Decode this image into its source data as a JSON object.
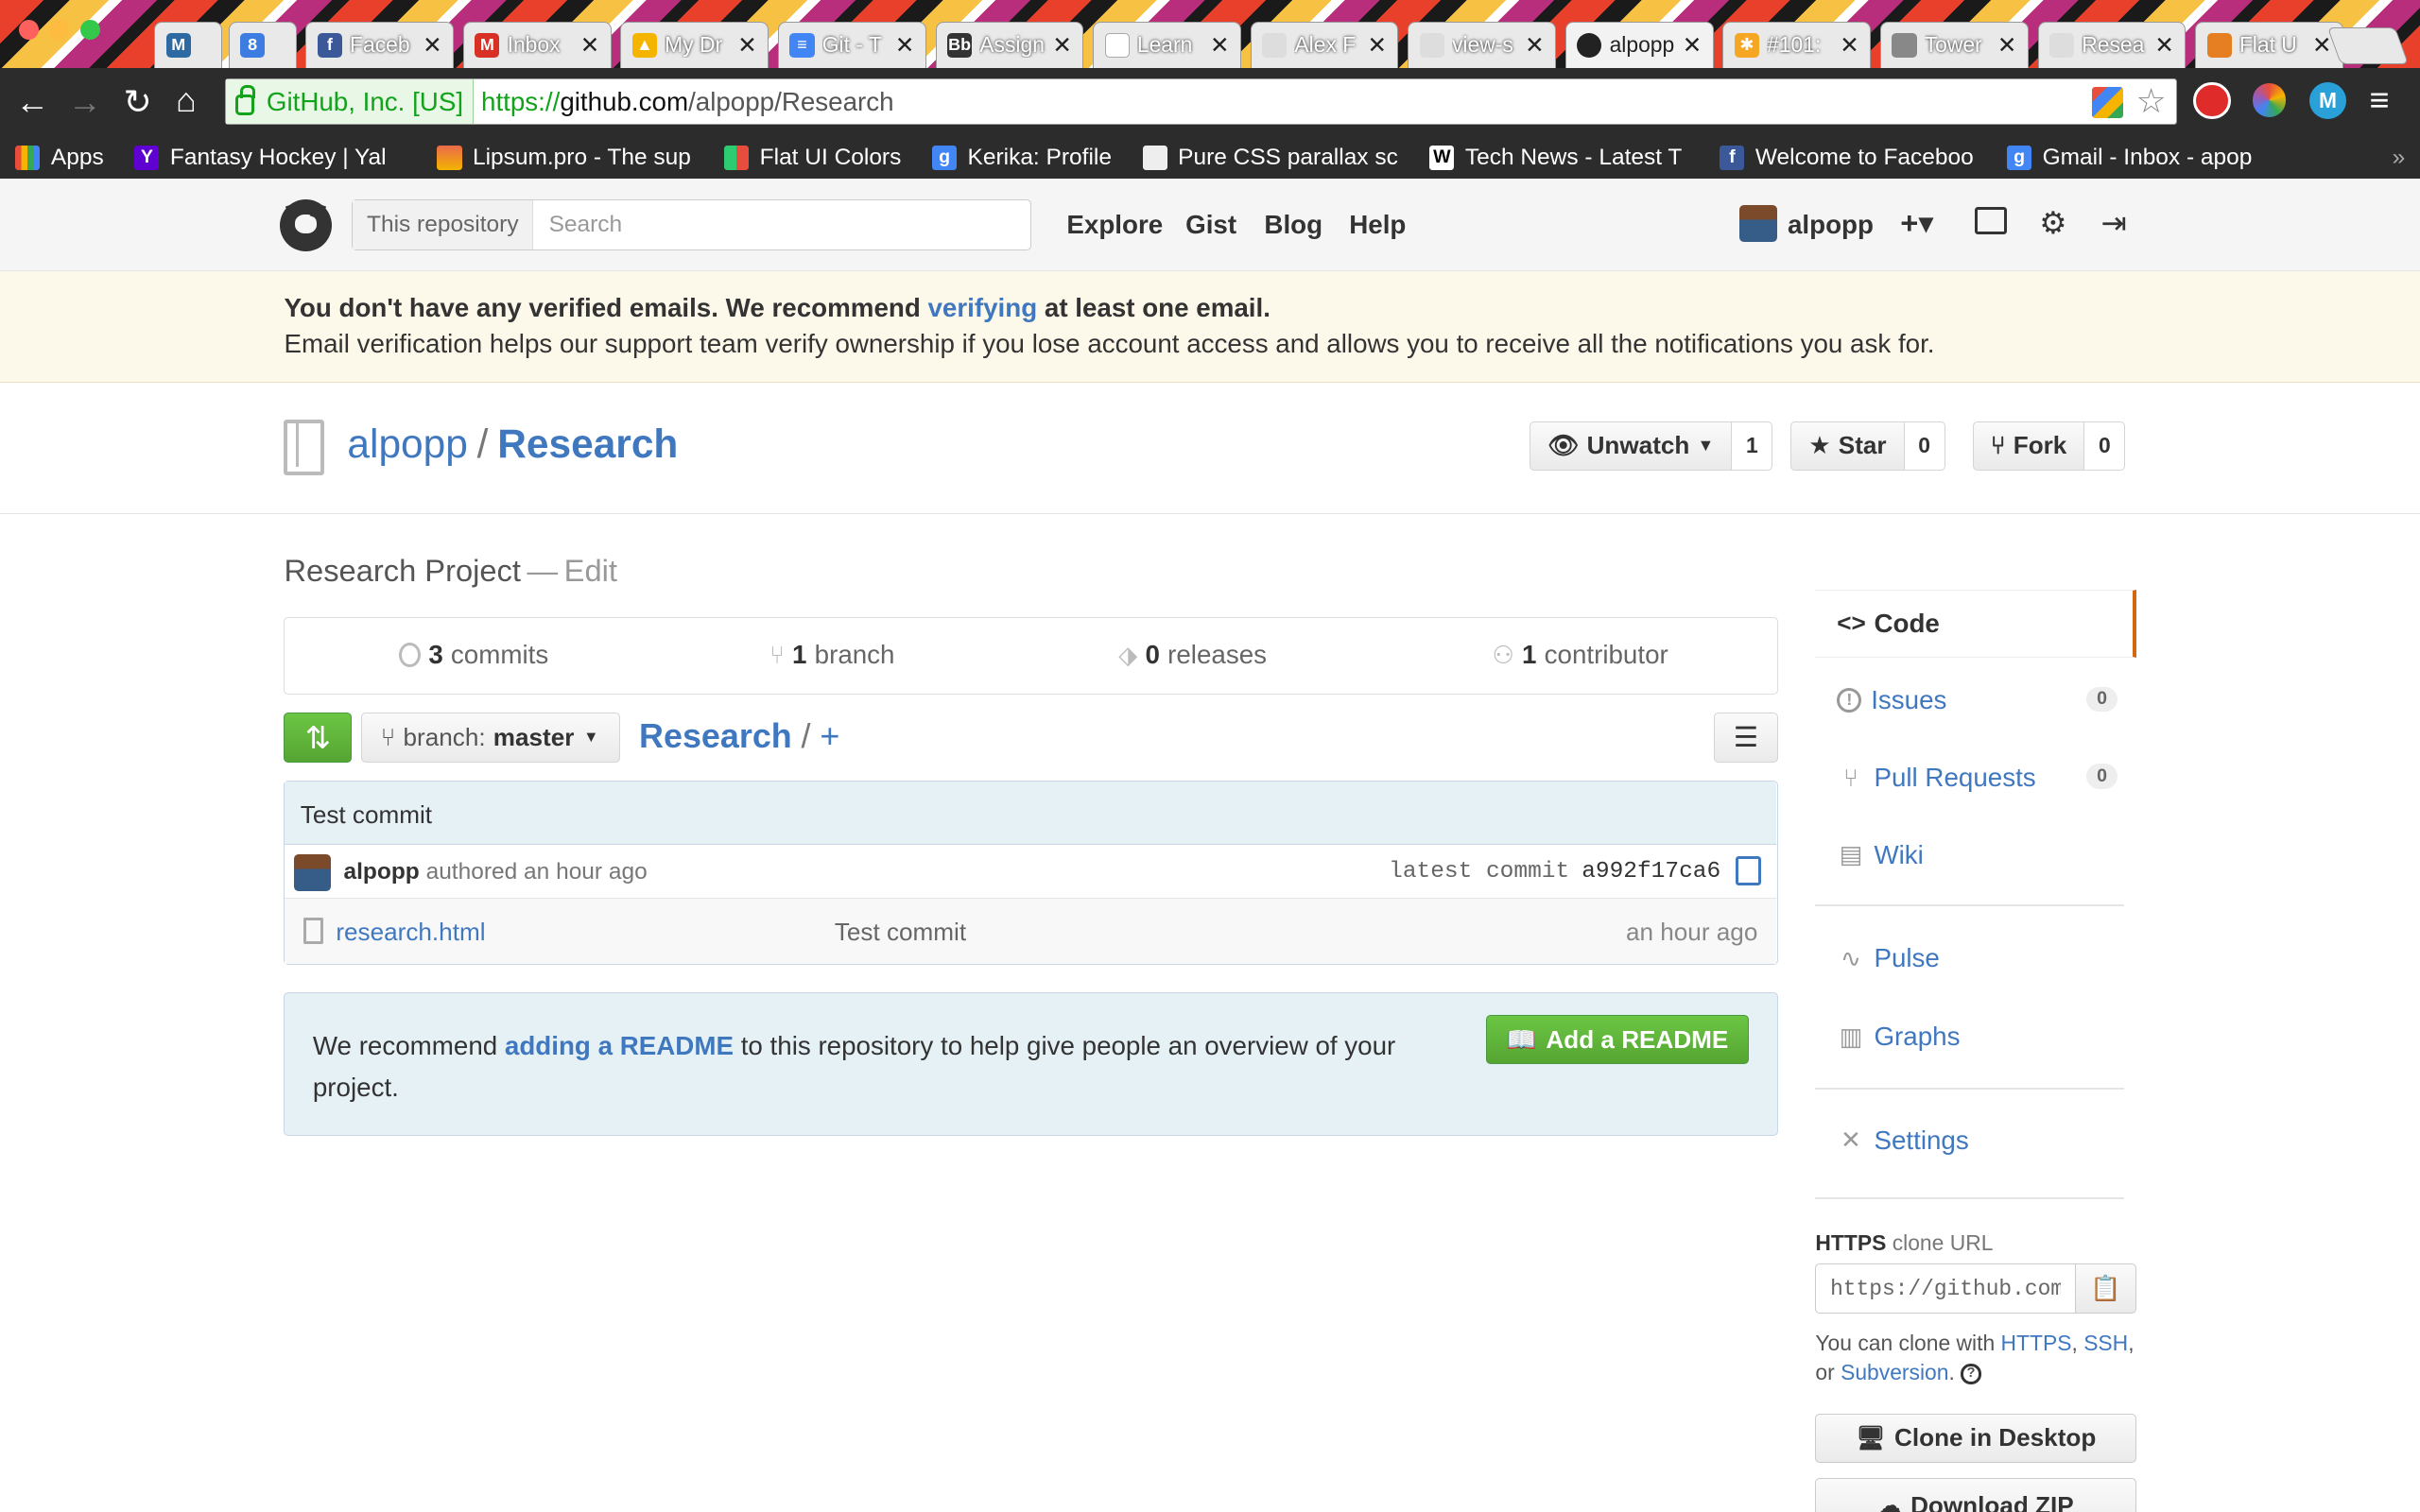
{
  "browser": {
    "tabs": [
      {
        "icon": "M",
        "label": "",
        "color": "#2d6aa3"
      },
      {
        "icon": "8",
        "label": "",
        "color": "#3d7ce0"
      },
      {
        "icon": "f",
        "label": "Faceb",
        "color": "#3b5998"
      },
      {
        "icon": "M",
        "label": "Inbox",
        "color": "#d93025"
      },
      {
        "icon": "▲",
        "label": "My Dr",
        "color": "#f4b400"
      },
      {
        "icon": "≡",
        "label": "Git - T",
        "color": "#4285f4"
      },
      {
        "icon": "Bb",
        "label": "Assign",
        "color": "#333333"
      },
      {
        "icon": "",
        "label": "Learn",
        "color": "#ffffff"
      },
      {
        "icon": "",
        "label": "Alex F",
        "color": "#dddddd"
      },
      {
        "icon": "",
        "label": "view-s",
        "color": "#dddddd"
      },
      {
        "icon": "",
        "label": "alpopp",
        "color": "#222222",
        "active": true
      },
      {
        "icon": "✱",
        "label": "#101:",
        "color": "#f5a623"
      },
      {
        "icon": "",
        "label": "Tower",
        "color": "#888888"
      },
      {
        "icon": "",
        "label": "Resea",
        "color": "#dddddd"
      },
      {
        "icon": "",
        "label": "Flat U",
        "color": "#e67e22"
      }
    ],
    "ev_cert": "GitHub, Inc. [US]",
    "url_scheme": "https://",
    "url_host": "github.com",
    "url_path": "/alpopp/Research",
    "bookmarks": [
      {
        "label": "Apps",
        "color": "#e94e3c"
      },
      {
        "label": "Fantasy Hockey | Yal",
        "color": "#5f01d1",
        "icon": "Y"
      },
      {
        "label": "Lipsum.pro - The sup",
        "color": "#e96a4a"
      },
      {
        "label": "Flat UI Colors",
        "color": "#2ecc71"
      },
      {
        "label": "Kerika: Profile",
        "color": "#4285f4",
        "icon": "g"
      },
      {
        "label": "Pure CSS parallax sc",
        "color": "#eeeeee"
      },
      {
        "label": "Tech News - Latest T",
        "color": "#ffffff",
        "icon": "W"
      },
      {
        "label": "Welcome to Faceboo",
        "color": "#3b5998",
        "icon": "f"
      },
      {
        "label": "Gmail - Inbox - apop",
        "color": "#4285f4",
        "icon": "g"
      }
    ],
    "bookmarks_more": "»"
  },
  "header": {
    "search_scope": "This repository",
    "search_placeholder": "Search",
    "nav": [
      "Explore",
      "Gist",
      "Blog",
      "Help"
    ],
    "username": "alpopp",
    "plus": "+▾"
  },
  "flash": {
    "line1_pre": "You don't have any verified emails. We recommend ",
    "line1_link": "verifying",
    "line1_post": " at least one email.",
    "line2": "Email verification helps our support team verify ownership if you lose account access and allows you to receive all the notifications you ask for."
  },
  "repo": {
    "owner": "alpopp",
    "separator": "/",
    "name": "Research",
    "unwatch_label": "Unwatch",
    "unwatch_count": "1",
    "star_label": "Star",
    "star_count": "0",
    "fork_label": "Fork",
    "fork_count": "0",
    "description": "Research Project",
    "desc_dash": "—",
    "edit_label": "Edit"
  },
  "summary": {
    "commits_num": "3",
    "commits_label": "commits",
    "branch_num": "1",
    "branch_label": "branch",
    "releases_num": "0",
    "releases_label": "releases",
    "contrib_num": "1",
    "contrib_label": "contributor"
  },
  "filenav": {
    "branch_prefix": "branch:",
    "branch_name": "master",
    "crumb_repo": "Research",
    "crumb_sep": "/",
    "crumb_plus": "+"
  },
  "commit": {
    "message": "Test commit",
    "author": "alpopp",
    "authored": "authored an hour ago",
    "latest_label": "latest commit",
    "sha": "a992f17ca6"
  },
  "files": [
    {
      "name": "research.html",
      "message": "Test commit",
      "age": "an hour ago"
    }
  ],
  "readme_prompt": {
    "pre": "We recommend ",
    "link": "adding a README",
    "post": " to this repository to help give people an overview of your project.",
    "button": "Add a README"
  },
  "sidebar": {
    "items": [
      {
        "label": "Code",
        "icon": "<>"
      },
      {
        "label": "Issues",
        "icon": "!",
        "count": "0"
      },
      {
        "label": "Pull Requests",
        "icon": "⑂",
        "count": "0"
      },
      {
        "label": "Wiki",
        "icon": "▤"
      },
      {
        "label": "Pulse",
        "icon": "∿"
      },
      {
        "label": "Graphs",
        "icon": "▥"
      },
      {
        "label": "Settings",
        "icon": "✕"
      }
    ],
    "clone_proto": "HTTPS",
    "clone_label": "clone URL",
    "clone_url": "https://github.com/alpopp/Research.git",
    "clone_note_pre": "You can clone with ",
    "clone_https": "HTTPS",
    "clone_comma": ", ",
    "clone_ssh": "SSH",
    "clone_or": ", or ",
    "clone_svn": "Subversion",
    "clone_period": ".",
    "clone_desktop": "Clone in Desktop",
    "download_zip": "Download ZIP"
  },
  "colors": {
    "link": "#4078c0",
    "green_button": "#6cc644",
    "selected_tab_accent": "#d26911"
  }
}
